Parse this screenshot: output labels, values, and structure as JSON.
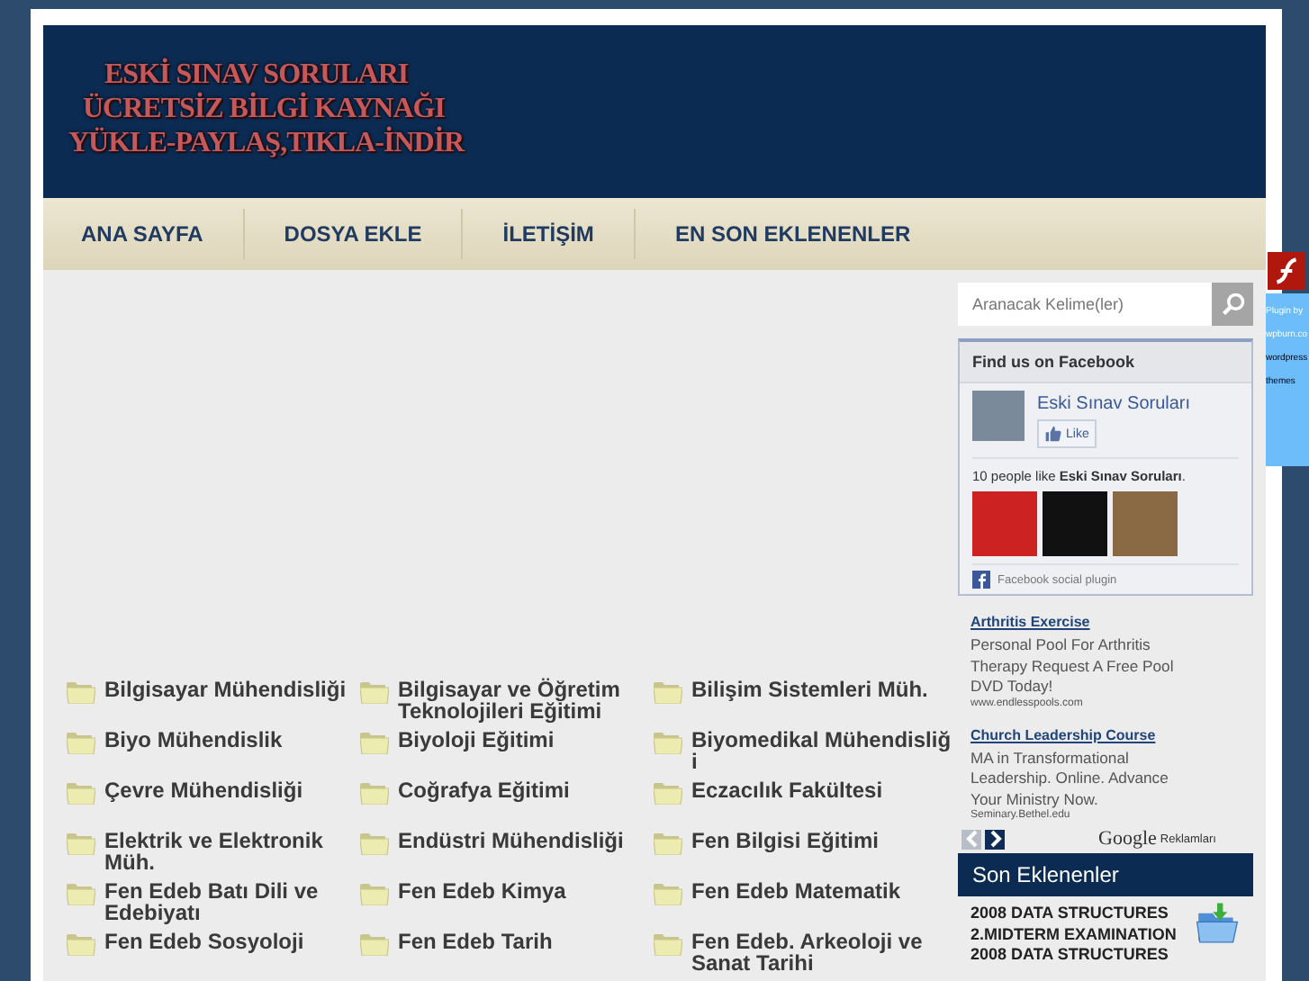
{
  "logo": {
    "lines": [
      "ESKİ SINAV SORULARI",
      "ÜCRETSİZ BİLGİ KAYNAĞI",
      "YÜKLE-PAYLAŞ,TIKLA-İNDİR"
    ]
  },
  "nav": [
    {
      "label": "ANA SAYFA"
    },
    {
      "label": "DOSYA EKLE"
    },
    {
      "label": "İLETİŞİM"
    },
    {
      "label": "EN SON EKLENENLER"
    }
  ],
  "categories": [
    "Bilgisayar Mühendisliği",
    "Bilgisayar ve Öğretim Teknolojileri Eğitimi",
    "Bilişim Sistemleri Müh.",
    "Biyo Mühendislik",
    "Biyoloji Eğitimi",
    "Biyomedikal Mühendisliğ i",
    "Çevre Mühendisliği",
    "Coğrafya Eğitimi",
    "Eczacılık Fakültesi",
    "Elektrik ve Elektronik Müh.",
    "Endüstri Mühendisliği",
    "Fen Bilgisi Eğitimi",
    "Fen Edeb Batı Dili ve Edebiyatı",
    "Fen Edeb Kimya",
    "Fen Edeb Matematik",
    "Fen Edeb Sosyoloji",
    "Fen Edeb Tarih",
    "Fen Edeb. Arkeoloji ve Sanat Tarihi"
  ],
  "search": {
    "placeholder": "Aranacak Kelime(ler)"
  },
  "facebook": {
    "title": "Find us on Facebook",
    "page_name": "Eski Sınav Soruları",
    "like": "Like",
    "fans": "10 people like **Eski Sınav Soruları**.",
    "footer": "Facebook social plugin"
  },
  "ads": [
    {
      "title": "Arthritis Exercise",
      "text": "Personal Pool For Arthritis Therapy Request A Free Pool DVD Today!",
      "url": "www.endlesspools.com"
    },
    {
      "title": "Church Leadership Course",
      "text": "MA in Transformational Leadership. Online. Advance Your Ministry Now.",
      "url": "Seminary.Bethel.edu"
    }
  ],
  "ads_footer": {
    "brand": "Google",
    "label": "Reklamları"
  },
  "recent": {
    "title": "Son Eklenenler",
    "items": [
      "2008 DATA STRUCTURES 2.MIDTERM EXAMINATION",
      "2008 DATA STRUCTURES"
    ]
  },
  "plugin": {
    "lines": [
      "Plugin by",
      "wpburn.co",
      "wordpress",
      "themes"
    ]
  }
}
